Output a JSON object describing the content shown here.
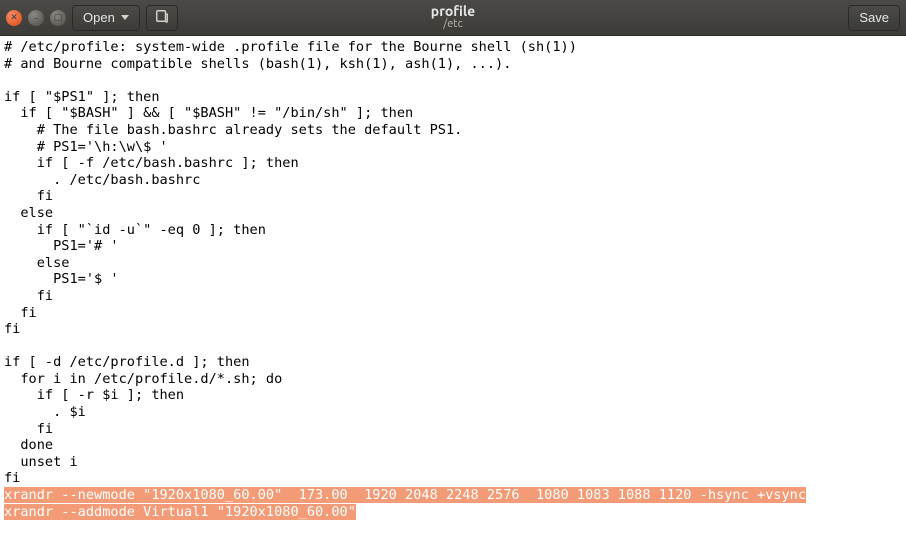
{
  "window": {
    "title": "profile",
    "subtitle": "/etc"
  },
  "toolbar": {
    "open_label": "Open",
    "save_label": "Save"
  },
  "editor": {
    "lines": [
      "# /etc/profile: system-wide .profile file for the Bourne shell (sh(1))",
      "# and Bourne compatible shells (bash(1), ksh(1), ash(1), ...).",
      "",
      "if [ \"$PS1\" ]; then",
      "  if [ \"$BASH\" ] && [ \"$BASH\" != \"/bin/sh\" ]; then",
      "    # The file bash.bashrc already sets the default PS1.",
      "    # PS1='\\h:\\w\\$ '",
      "    if [ -f /etc/bash.bashrc ]; then",
      "      . /etc/bash.bashrc",
      "    fi",
      "  else",
      "    if [ \"`id -u`\" -eq 0 ]; then",
      "      PS1='# '",
      "    else",
      "      PS1='$ '",
      "    fi",
      "  fi",
      "fi",
      "",
      "if [ -d /etc/profile.d ]; then",
      "  for i in /etc/profile.d/*.sh; do",
      "    if [ -r $i ]; then",
      "      . $i",
      "    fi",
      "  done",
      "  unset i",
      "fi"
    ],
    "highlighted_lines": [
      "xrandr --newmode \"1920x1080_60.00\"  173.00  1920 2048 2248 2576  1080 1083 1088 1120 -hsync +vsync",
      "xrandr --addmode Virtual1 \"1920x1080_60.00\""
    ]
  }
}
